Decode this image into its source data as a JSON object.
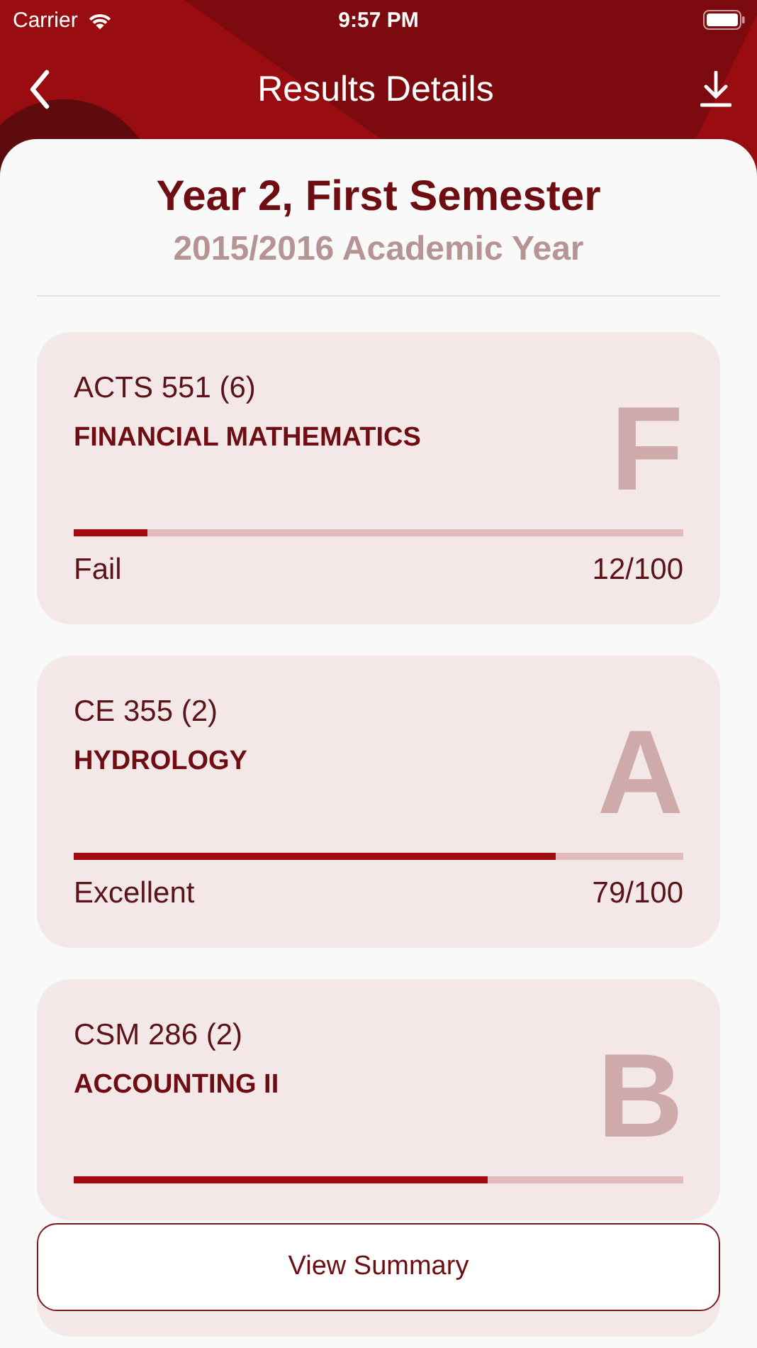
{
  "status_bar": {
    "carrier": "Carrier",
    "time": "9:57 PM"
  },
  "nav": {
    "title": "Results Details"
  },
  "header": {
    "title": "Year 2, First Semester",
    "subtitle": "2015/2016 Academic Year"
  },
  "courses": [
    {
      "code": "ACTS 551 (6)",
      "name": "FINANCIAL MATHEMATICS",
      "grade": "F",
      "level": 0.12,
      "status": "Fail",
      "score": "12/100"
    },
    {
      "code": "CE 355 (2)",
      "name": "HYDROLOGY",
      "grade": "A",
      "level": 0.79,
      "status": "Excellent",
      "score": "79/100"
    },
    {
      "code": "CSM 286 (2)",
      "name": "ACCOUNTING II",
      "grade": "B",
      "level": 0.68
    }
  ],
  "summary_button": {
    "label": "View Summary"
  }
}
